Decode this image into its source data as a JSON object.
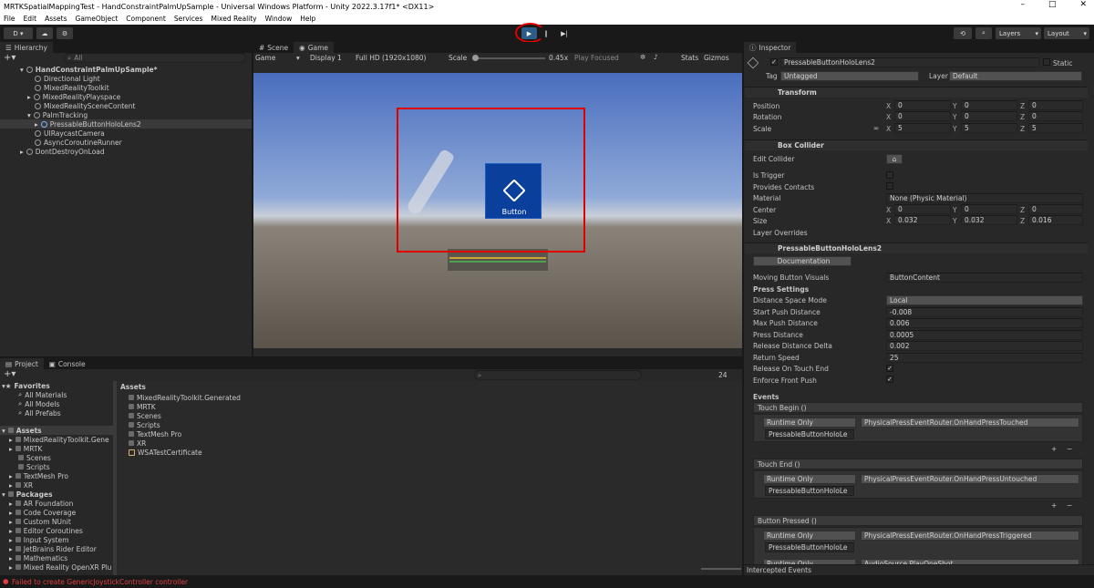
{
  "title": "MRTKSpatialMappingTest - HandConstraintPalmUpSample - Universal Windows Platform - Unity 2022.3.17f1* <DX11>",
  "window_buttons": [
    "–",
    "□",
    "✕"
  ],
  "menu": [
    "File",
    "Edit",
    "Assets",
    "GameObject",
    "Component",
    "Services",
    "Mixed Reality",
    "Window",
    "Help"
  ],
  "toolbar": {
    "account": "D ▾",
    "layers": "Layers",
    "layout": "Layout",
    "play": "▶",
    "pause": "‖",
    "step": "▶|"
  },
  "hierarchy": {
    "tab": "Hierarchy",
    "search_placeholder": "All",
    "scene": "HandConstraintPalmUpSample*",
    "items": [
      {
        "label": "Directional Light"
      },
      {
        "label": "MixedRealityToolkit"
      },
      {
        "label": "MixedRealityPlayspace"
      },
      {
        "label": "MixedRealitySceneContent"
      },
      {
        "label": "PalmTracking"
      },
      {
        "label": "PressableButtonHoloLens2"
      },
      {
        "label": "UIRaycastCamera"
      },
      {
        "label": "AsyncCoroutineRunner"
      }
    ],
    "dont_destroy": "DontDestroyOnLoad"
  },
  "game": {
    "tab_scene": "Scene",
    "tab_game": "Game",
    "mode": "Game",
    "display": "Display 1",
    "resolution": "Full HD (1920x1080)",
    "scale_label": "Scale",
    "scale_value": "0.45x",
    "play_focused": "Play Focused",
    "stats": "Stats",
    "gizmos": "Gizmos",
    "button_label": "Button"
  },
  "project": {
    "tab_project": "Project",
    "tab_console": "Console",
    "count": "24",
    "favorites": "Favorites",
    "fav_items": [
      "All Materials",
      "All Models",
      "All Prefabs"
    ],
    "assets_header": "Assets",
    "asset_tree": [
      "MixedRealityToolkit.Gene",
      "MRTK",
      "Scenes",
      "Scripts",
      "TextMesh Pro",
      "XR"
    ],
    "packages": "Packages",
    "package_items": [
      "AR Foundation",
      "Code Coverage",
      "Custom NUnit",
      "Editor Coroutines",
      "Input System",
      "JetBrains Rider Editor",
      "Mathematics",
      "Mixed Reality OpenXR Plu"
    ],
    "breadcrumb": "Assets",
    "files": [
      "MixedRealityToolkit.Generated",
      "MRTK",
      "Scenes",
      "Scripts",
      "TextMesh Pro",
      "XR",
      "WSATestCertificate"
    ]
  },
  "status": {
    "error": "Failed to create GenericJoystickController controller"
  },
  "inspector": {
    "tab": "Inspector",
    "object_name": "PressableButtonHoloLens2",
    "static": "Static",
    "tag_label": "Tag",
    "tag": "Untagged",
    "layer_label": "Layer",
    "layer": "Default",
    "transform": {
      "title": "Transform",
      "position_label": "Position",
      "rotation_label": "Rotation",
      "scale_label": "Scale",
      "position": [
        "0",
        "0",
        "0"
      ],
      "rotation": [
        "0",
        "0",
        "0"
      ],
      "scale": [
        "5",
        "5",
        "5"
      ]
    },
    "box_collider": {
      "title": "Box Collider",
      "edit": "Edit Collider",
      "is_trigger": "Is Trigger",
      "provides_contacts": "Provides Contacts",
      "material_label": "Material",
      "material": "None (Physic Material)",
      "center_label": "Center",
      "center": [
        "0",
        "0",
        "0"
      ],
      "size_label": "Size",
      "size": [
        "0.032",
        "0.032",
        "0.016"
      ],
      "layer_overrides": "Layer Overrides"
    },
    "script": {
      "title": "PressableButtonHoloLens2",
      "documentation": "Documentation",
      "moving_visuals_label": "Moving Button Visuals",
      "moving_visuals": "ButtonContent",
      "press_settings": "Press Settings",
      "props": [
        {
          "label": "Distance Space Mode",
          "value": "Local"
        },
        {
          "label": "Start Push Distance",
          "value": "-0.008"
        },
        {
          "label": "Max Push Distance",
          "value": "0.006"
        },
        {
          "label": "Press Distance",
          "value": "0.0005"
        },
        {
          "label": "Release Distance Delta",
          "value": "0.002"
        },
        {
          "label": "Return Speed",
          "value": "25"
        }
      ],
      "release_on_touch_end": "Release On Touch End",
      "enforce_front_push": "Enforce Front Push",
      "events": "Events",
      "event_list": [
        {
          "name": "Touch Begin ()",
          "mode": "Runtime Only",
          "func": "PhysicalPressEventRouter.OnHandPressTouched",
          "target": "PressableButtonHoloLe"
        },
        {
          "name": "Touch End ()",
          "mode": "Runtime Only",
          "func": "PhysicalPressEventRouter.OnHandPressUntouched",
          "target": "PressableButtonHoloLe"
        },
        {
          "name": "Button Pressed ()",
          "mode": "Runtime Only",
          "func": "PhysicalPressEventRouter.OnHandPressTriggered",
          "target": "PressableButtonHoloLe"
        }
      ],
      "partial_mode": "Runtime Only",
      "partial_func": "AudioSource.PlayOneShot"
    },
    "intercepted": "Intercepted Events"
  }
}
